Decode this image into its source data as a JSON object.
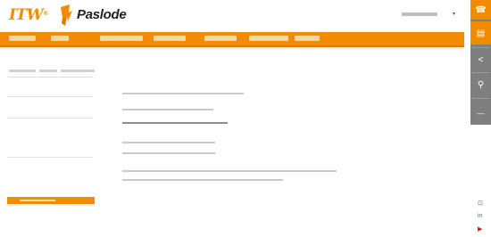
{
  "header": {
    "itw_logo": "ITW",
    "brand": "Paslode",
    "language_selector": "",
    "language_arrow": "▾"
  },
  "nav": {
    "items": [
      "",
      "",
      "",
      "",
      "",
      "",
      "",
      ""
    ]
  },
  "right_rail": {
    "buttons": [
      {
        "icon": "phone-icon",
        "glyph": "☎"
      },
      {
        "icon": "document-icon",
        "glyph": "▤"
      },
      {
        "icon": "share-icon",
        "glyph": "<"
      },
      {
        "icon": "location-pin-icon",
        "glyph": "⚲"
      },
      {
        "icon": "collapse-icon",
        "glyph": "—"
      }
    ]
  },
  "page": {
    "title": ""
  },
  "sidebar": {
    "items": [
      "",
      "",
      "",
      "",
      "",
      "",
      "",
      "",
      ""
    ],
    "active_item": ""
  },
  "corner_icons": {
    "twitter": "⊡",
    "linkedin": "in",
    "youtube": "▶"
  },
  "colors": {
    "accent": "#f28b00",
    "rail": "#7f7f7f"
  }
}
